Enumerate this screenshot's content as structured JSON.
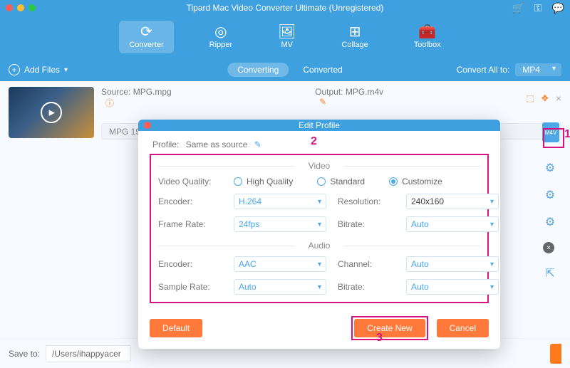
{
  "window": {
    "title": "Tipard Mac Video Converter Ultimate (Unregistered)"
  },
  "nav": {
    "items": [
      {
        "label": "Converter",
        "icon": "refresh-icon"
      },
      {
        "label": "Ripper",
        "icon": "target-icon"
      },
      {
        "label": "MV",
        "icon": "image-icon"
      },
      {
        "label": "Collage",
        "icon": "grid-icon"
      },
      {
        "label": "Toolbox",
        "icon": "toolbox-icon"
      }
    ]
  },
  "toolbar": {
    "add_files": "Add Files",
    "converting": "Converting",
    "converted": "Converted",
    "convert_all_to": "Convert All to:",
    "format": "MP4"
  },
  "source": {
    "label": "Source:",
    "value": "MPG.mpg"
  },
  "output": {
    "label": "Output:",
    "value": "MPG.m4v"
  },
  "clip_row": "MPG   19",
  "badge": "M4V",
  "save": {
    "label": "Save to:",
    "path": "/Users/ihappyacer"
  },
  "modal": {
    "title": "Edit Profile",
    "profile_label": "Profile:",
    "profile_value": "Same as source",
    "video_header": "Video",
    "audio_header": "Audio",
    "video": {
      "quality_label": "Video Quality:",
      "quality_options": {
        "high": "High Quality",
        "standard": "Standard",
        "customize": "Customize"
      },
      "encoder_label": "Encoder:",
      "encoder": "H.264",
      "resolution_label": "Resolution:",
      "resolution": "240x160",
      "frame_rate_label": "Frame Rate:",
      "frame_rate": "24fps",
      "bitrate_label": "Bitrate:",
      "bitrate": "Auto"
    },
    "audio": {
      "encoder_label": "Encoder:",
      "encoder": "AAC",
      "channel_label": "Channel:",
      "channel": "Auto",
      "sample_rate_label": "Sample Rate:",
      "sample_rate": "Auto",
      "bitrate_label": "Bitrate:",
      "bitrate": "Auto"
    },
    "buttons": {
      "default": "Default",
      "create_new": "Create New",
      "cancel": "Cancel"
    }
  },
  "annotations": {
    "one": "1",
    "two": "2",
    "three": "3"
  }
}
